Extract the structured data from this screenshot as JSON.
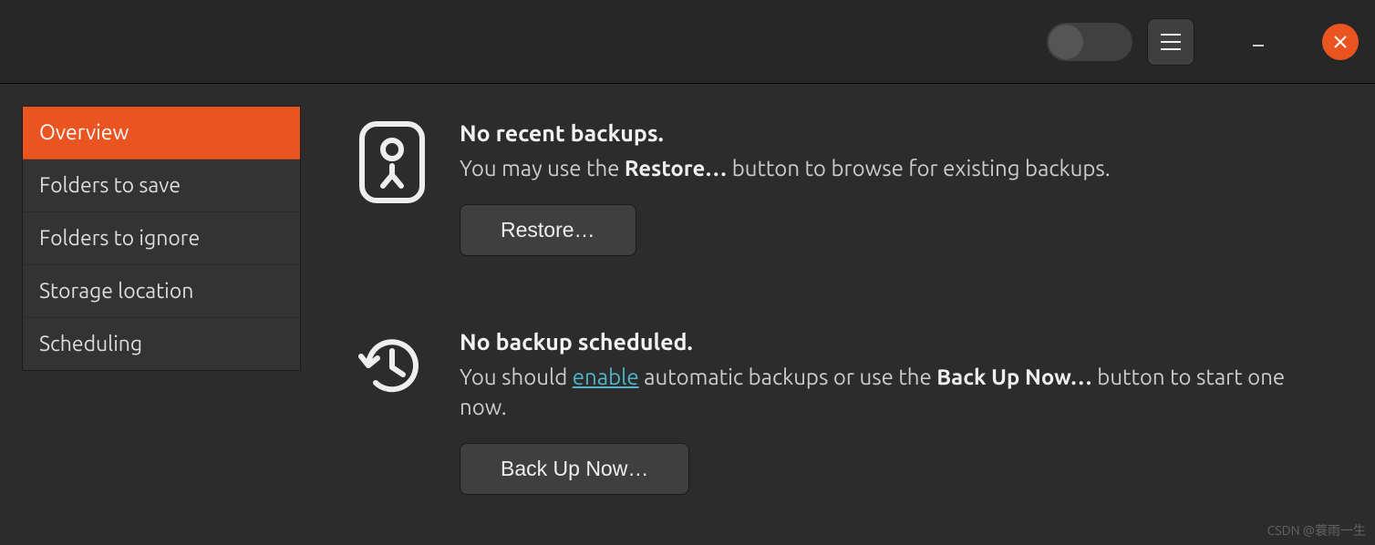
{
  "header": {
    "toggle_state": "off"
  },
  "sidebar": {
    "items": [
      {
        "label": "Overview",
        "active": true
      },
      {
        "label": "Folders to save",
        "active": false
      },
      {
        "label": "Folders to ignore",
        "active": false
      },
      {
        "label": "Storage location",
        "active": false
      },
      {
        "label": "Scheduling",
        "active": false
      }
    ]
  },
  "overview": {
    "restore": {
      "title": "No recent backups.",
      "desc_pre": "You may use the ",
      "desc_bold": "Restore…",
      "desc_post": " button to browse for existing backups.",
      "button": "Restore…"
    },
    "backup": {
      "title": "No backup scheduled.",
      "desc_pre": "You should ",
      "desc_link": "enable",
      "desc_mid": " automatic backups or use the ",
      "desc_bold": "Back Up Now…",
      "desc_post": " button to start one now.",
      "button": "Back Up Now…"
    }
  },
  "watermark": "CSDN @蓑雨一生"
}
